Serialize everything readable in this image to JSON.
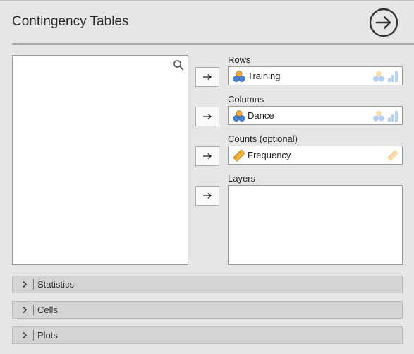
{
  "header": {
    "title": "Contingency Tables",
    "run_icon": "arrow-right-circle-icon"
  },
  "variables_list": {
    "search_icon": "search-icon"
  },
  "assign_button_icon": "arrow-right-icon",
  "rows": {
    "label": "Rows",
    "value": "Training",
    "value_icon": "nominal-variable-icon",
    "allowed_icons": [
      "nominal-variable-icon",
      "ordinal-variable-icon"
    ]
  },
  "columns": {
    "label": "Columns",
    "value": "Dance",
    "value_icon": "nominal-variable-icon",
    "allowed_icons": [
      "nominal-variable-icon",
      "ordinal-variable-icon"
    ]
  },
  "counts": {
    "label": "Counts (optional)",
    "value": "Frequency",
    "value_icon": "scale-variable-icon",
    "allowed_icons": [
      "scale-variable-icon"
    ]
  },
  "layers": {
    "label": "Layers"
  },
  "sections": [
    {
      "label": "Statistics"
    },
    {
      "label": "Cells"
    },
    {
      "label": "Plots"
    }
  ],
  "colors": {
    "background": "#e6e6e6",
    "nominal_orange": "#f0a93b",
    "nominal_blue": "#4a86d8",
    "scale_gold": "#f3b33d"
  }
}
